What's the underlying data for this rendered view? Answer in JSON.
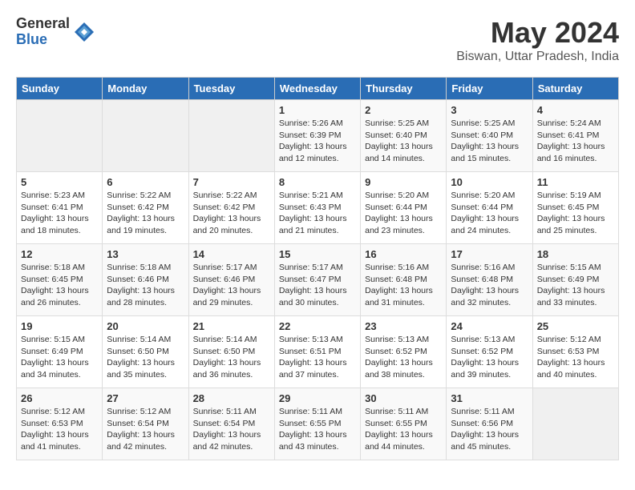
{
  "logo": {
    "general": "General",
    "blue": "Blue"
  },
  "title": "May 2024",
  "location": "Biswan, Uttar Pradesh, India",
  "days_header": [
    "Sunday",
    "Monday",
    "Tuesday",
    "Wednesday",
    "Thursday",
    "Friday",
    "Saturday"
  ],
  "weeks": [
    [
      {
        "day": "",
        "info": ""
      },
      {
        "day": "",
        "info": ""
      },
      {
        "day": "",
        "info": ""
      },
      {
        "day": "1",
        "info": "Sunrise: 5:26 AM\nSunset: 6:39 PM\nDaylight: 13 hours\nand 12 minutes."
      },
      {
        "day": "2",
        "info": "Sunrise: 5:25 AM\nSunset: 6:40 PM\nDaylight: 13 hours\nand 14 minutes."
      },
      {
        "day": "3",
        "info": "Sunrise: 5:25 AM\nSunset: 6:40 PM\nDaylight: 13 hours\nand 15 minutes."
      },
      {
        "day": "4",
        "info": "Sunrise: 5:24 AM\nSunset: 6:41 PM\nDaylight: 13 hours\nand 16 minutes."
      }
    ],
    [
      {
        "day": "5",
        "info": "Sunrise: 5:23 AM\nSunset: 6:41 PM\nDaylight: 13 hours\nand 18 minutes."
      },
      {
        "day": "6",
        "info": "Sunrise: 5:22 AM\nSunset: 6:42 PM\nDaylight: 13 hours\nand 19 minutes."
      },
      {
        "day": "7",
        "info": "Sunrise: 5:22 AM\nSunset: 6:42 PM\nDaylight: 13 hours\nand 20 minutes."
      },
      {
        "day": "8",
        "info": "Sunrise: 5:21 AM\nSunset: 6:43 PM\nDaylight: 13 hours\nand 21 minutes."
      },
      {
        "day": "9",
        "info": "Sunrise: 5:20 AM\nSunset: 6:44 PM\nDaylight: 13 hours\nand 23 minutes."
      },
      {
        "day": "10",
        "info": "Sunrise: 5:20 AM\nSunset: 6:44 PM\nDaylight: 13 hours\nand 24 minutes."
      },
      {
        "day": "11",
        "info": "Sunrise: 5:19 AM\nSunset: 6:45 PM\nDaylight: 13 hours\nand 25 minutes."
      }
    ],
    [
      {
        "day": "12",
        "info": "Sunrise: 5:18 AM\nSunset: 6:45 PM\nDaylight: 13 hours\nand 26 minutes."
      },
      {
        "day": "13",
        "info": "Sunrise: 5:18 AM\nSunset: 6:46 PM\nDaylight: 13 hours\nand 28 minutes."
      },
      {
        "day": "14",
        "info": "Sunrise: 5:17 AM\nSunset: 6:46 PM\nDaylight: 13 hours\nand 29 minutes."
      },
      {
        "day": "15",
        "info": "Sunrise: 5:17 AM\nSunset: 6:47 PM\nDaylight: 13 hours\nand 30 minutes."
      },
      {
        "day": "16",
        "info": "Sunrise: 5:16 AM\nSunset: 6:48 PM\nDaylight: 13 hours\nand 31 minutes."
      },
      {
        "day": "17",
        "info": "Sunrise: 5:16 AM\nSunset: 6:48 PM\nDaylight: 13 hours\nand 32 minutes."
      },
      {
        "day": "18",
        "info": "Sunrise: 5:15 AM\nSunset: 6:49 PM\nDaylight: 13 hours\nand 33 minutes."
      }
    ],
    [
      {
        "day": "19",
        "info": "Sunrise: 5:15 AM\nSunset: 6:49 PM\nDaylight: 13 hours\nand 34 minutes."
      },
      {
        "day": "20",
        "info": "Sunrise: 5:14 AM\nSunset: 6:50 PM\nDaylight: 13 hours\nand 35 minutes."
      },
      {
        "day": "21",
        "info": "Sunrise: 5:14 AM\nSunset: 6:50 PM\nDaylight: 13 hours\nand 36 minutes."
      },
      {
        "day": "22",
        "info": "Sunrise: 5:13 AM\nSunset: 6:51 PM\nDaylight: 13 hours\nand 37 minutes."
      },
      {
        "day": "23",
        "info": "Sunrise: 5:13 AM\nSunset: 6:52 PM\nDaylight: 13 hours\nand 38 minutes."
      },
      {
        "day": "24",
        "info": "Sunrise: 5:13 AM\nSunset: 6:52 PM\nDaylight: 13 hours\nand 39 minutes."
      },
      {
        "day": "25",
        "info": "Sunrise: 5:12 AM\nSunset: 6:53 PM\nDaylight: 13 hours\nand 40 minutes."
      }
    ],
    [
      {
        "day": "26",
        "info": "Sunrise: 5:12 AM\nSunset: 6:53 PM\nDaylight: 13 hours\nand 41 minutes."
      },
      {
        "day": "27",
        "info": "Sunrise: 5:12 AM\nSunset: 6:54 PM\nDaylight: 13 hours\nand 42 minutes."
      },
      {
        "day": "28",
        "info": "Sunrise: 5:11 AM\nSunset: 6:54 PM\nDaylight: 13 hours\nand 42 minutes."
      },
      {
        "day": "29",
        "info": "Sunrise: 5:11 AM\nSunset: 6:55 PM\nDaylight: 13 hours\nand 43 minutes."
      },
      {
        "day": "30",
        "info": "Sunrise: 5:11 AM\nSunset: 6:55 PM\nDaylight: 13 hours\nand 44 minutes."
      },
      {
        "day": "31",
        "info": "Sunrise: 5:11 AM\nSunset: 6:56 PM\nDaylight: 13 hours\nand 45 minutes."
      },
      {
        "day": "",
        "info": ""
      }
    ]
  ]
}
